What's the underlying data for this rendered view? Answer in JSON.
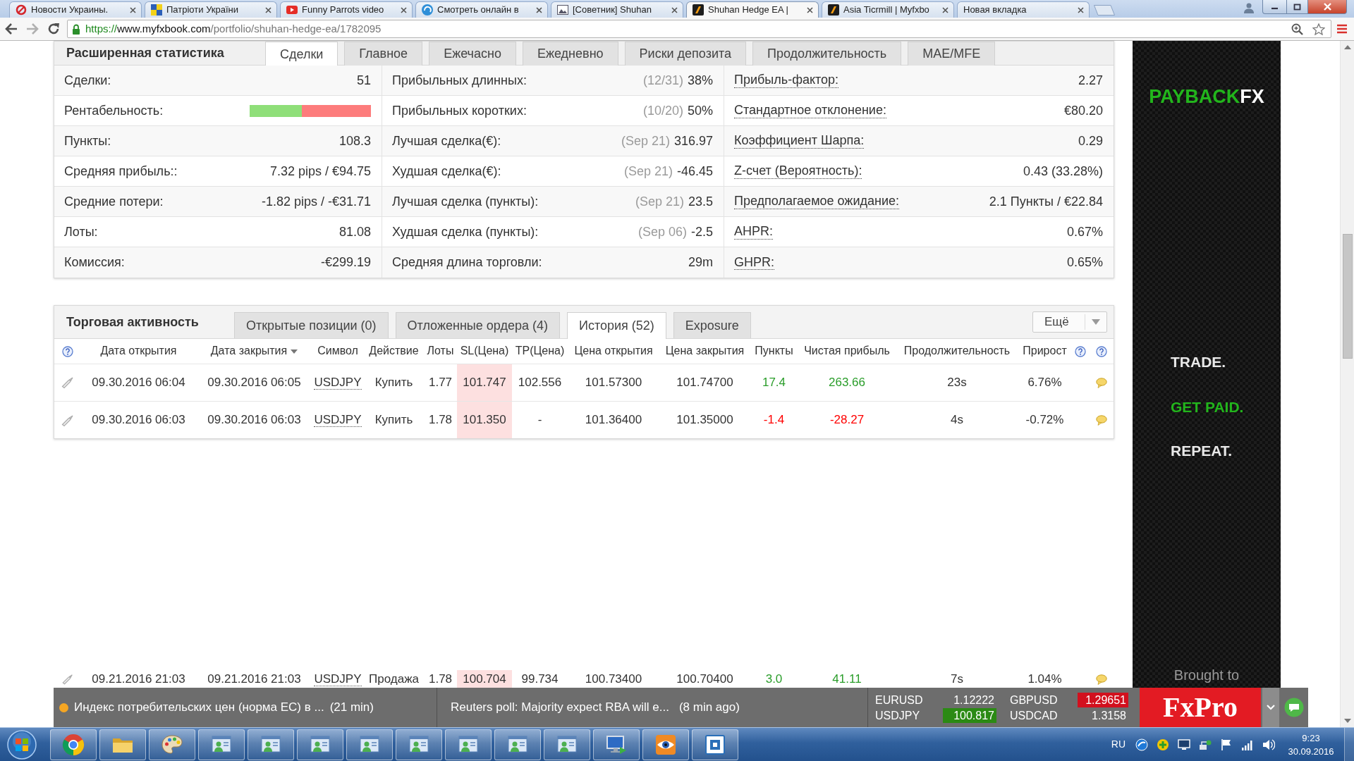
{
  "browser": {
    "tabs": [
      {
        "title": "Новости Украины.",
        "selected": false
      },
      {
        "title": "Патріоти України",
        "selected": false
      },
      {
        "title": "Funny Parrots video",
        "selected": false
      },
      {
        "title": "Смотреть онлайн в",
        "selected": false
      },
      {
        "title": "[Советник] Shuhan",
        "selected": false
      },
      {
        "title": "Shuhan Hedge EA |",
        "selected": true
      },
      {
        "title": "Asia Ticrmill | Myfxbo",
        "selected": false
      },
      {
        "title": "Новая вкладка",
        "selected": false
      }
    ],
    "address": {
      "scheme": "https://",
      "host": "www.myfxbook.com",
      "path": "/portfolio/shuhan-hedge-ea/1782095"
    }
  },
  "stats": {
    "title": "Расширенная статистика",
    "tabs": [
      {
        "label": "Сделки",
        "selected": true
      },
      {
        "label": "Главное",
        "selected": false
      },
      {
        "label": "Ежечасно",
        "selected": false
      },
      {
        "label": "Ежедневно",
        "selected": false
      },
      {
        "label": "Риски депозита",
        "selected": false
      },
      {
        "label": "Продолжительность",
        "selected": false
      },
      {
        "label": "MAE/MFE",
        "selected": false
      }
    ],
    "rows": [
      [
        {
          "kind": "text",
          "label": "Сделки:",
          "value": "51"
        },
        {
          "kind": "text",
          "label": "Прибыльных длинных:",
          "note": "(12/31)",
          "value": "38%"
        },
        {
          "kind": "text",
          "label": "Прибыль-фактор:",
          "value": "2.27"
        }
      ],
      [
        {
          "kind": "bar",
          "label": "Рентабельность:",
          "level": 0.43
        },
        {
          "kind": "text",
          "label": "Прибыльных коротких:",
          "note": "(10/20)",
          "value": "50%"
        },
        {
          "kind": "text",
          "label": "Стандартное отклонение:",
          "value": "€80.20"
        }
      ],
      [
        {
          "kind": "text",
          "label": "Пункты:",
          "value": "108.3"
        },
        {
          "kind": "text",
          "label": "Лучшая сделка(€):",
          "note": "(Sep 21)",
          "value": "316.97"
        },
        {
          "kind": "text",
          "label": "Коэффициент Шарпа:",
          "value": "0.29"
        }
      ],
      [
        {
          "kind": "text",
          "label": "Средняя прибыль::",
          "value": "7.32 pips / €94.75"
        },
        {
          "kind": "text",
          "label": "Худшая сделка(€):",
          "note": "(Sep 21)",
          "value": "-46.45"
        },
        {
          "kind": "text",
          "label": "Z-счет (Вероятность):",
          "value": "0.43 (33.28%)"
        }
      ],
      [
        {
          "kind": "text",
          "label": "Средние потери:",
          "value": "-1.82 pips / -€31.71"
        },
        {
          "kind": "text",
          "label": "Лучшая сделка (пункты):",
          "note": "(Sep 21)",
          "value": "23.5"
        },
        {
          "kind": "text",
          "label": "Предполагаемое ожидание:",
          "value": "2.1 Пункты / €22.84"
        }
      ],
      [
        {
          "kind": "text",
          "label": "Лоты:",
          "value": "81.08"
        },
        {
          "kind": "text",
          "label": "Худшая сделка (пункты):",
          "note": "(Sep 06)",
          "value": "-2.5"
        },
        {
          "kind": "text",
          "label": "AHPR:",
          "value": "0.67%"
        }
      ],
      [
        {
          "kind": "text",
          "label": "Комиссия:",
          "value": "-€299.19"
        },
        {
          "kind": "text",
          "label": "Средняя длина торговли:",
          "value": "29m"
        },
        {
          "kind": "text",
          "label": "GHPR:",
          "value": "0.65%"
        }
      ]
    ]
  },
  "trading": {
    "title": "Торговая активность",
    "tabs": [
      {
        "label": "Открытые позиции (0)",
        "selected": false
      },
      {
        "label": "Отложенные ордера (4)",
        "selected": false
      },
      {
        "label": "История (52)",
        "selected": true
      },
      {
        "label": "Exposure",
        "selected": false
      }
    ],
    "menu": "Ещё",
    "columns": [
      {
        "label": "Дата открытия",
        "sorted": false
      },
      {
        "label": "Дата закрытия",
        "sorted": true
      },
      {
        "label": "Символ",
        "sorted": false
      },
      {
        "label": "Действие",
        "sorted": false
      },
      {
        "label": "Лоты",
        "sorted": false
      },
      {
        "label": "SL(Цена)",
        "sorted": false
      },
      {
        "label": "TP(Цена)",
        "sorted": false
      },
      {
        "label": "Цена открытия",
        "sorted": false
      },
      {
        "label": "Цена закрытия",
        "sorted": false
      },
      {
        "label": "Пункты",
        "sorted": false
      },
      {
        "label": "Чистая прибыль",
        "sorted": false
      },
      {
        "label": "Продолжительность",
        "sorted": false
      },
      {
        "label": "Прирост",
        "sorted": false
      }
    ],
    "rows": [
      {
        "profit": true,
        "cells": [
          "09.30.2016 06:04",
          "09.30.2016 06:05",
          "USDJPY",
          "Купить",
          "1.77",
          "101.747",
          "102.556",
          "101.57300",
          "101.74700",
          "17.4",
          "263.66",
          "23s",
          "6.76%"
        ]
      },
      {
        "profit": false,
        "cells": [
          "09.30.2016 06:03",
          "09.30.2016 06:03",
          "USDJPY",
          "Купить",
          "1.78",
          "101.350",
          "-",
          "101.36400",
          "101.35000",
          "-1.4",
          "-28.27",
          "4s",
          "-0.72%"
        ]
      }
    ],
    "bottom_row": {
      "profit": true,
      "cells": [
        "09.21.2016 21:03",
        "09.21.2016 21:03",
        "USDJPY",
        "Продажа",
        "1.78",
        "100.704",
        "99.734",
        "100.73400",
        "100.70400",
        "3.0",
        "41.11",
        "7s",
        "1.04%"
      ]
    }
  },
  "ad": {
    "logo": {
      "word": "PAYBACK",
      "accent": "FX"
    },
    "slogans": [
      {
        "text": "TRADE.",
        "highlight": false
      },
      {
        "text": "GET PAID.",
        "highlight": true
      },
      {
        "text": "REPEAT.",
        "highlight": false
      }
    ],
    "credit": "Brought to"
  },
  "ticker": {
    "news": [
      {
        "kind": "event",
        "text": "Индекс потребительских цен (норма ЕС) в ...",
        "time": "(21 min)"
      },
      {
        "kind": "headline",
        "text": "Reuters poll: Majority expect RBA will e...",
        "time": "(8 min ago)"
      }
    ],
    "quotes": [
      {
        "symbol": "EURUSD",
        "price": "1.12222",
        "rising": false,
        "falling": false
      },
      {
        "symbol": "GBPUSD",
        "price": "1.29651",
        "rising": false,
        "falling": true
      },
      {
        "symbol": "USDJPY",
        "price": "100.817",
        "rising": true,
        "falling": false
      },
      {
        "symbol": "USDCAD",
        "price": "1.3158",
        "rising": false,
        "falling": false
      }
    ],
    "brand": "FxPro"
  },
  "taskbar": {
    "language": "RU",
    "time": "9:23",
    "date": "30.09.2016"
  }
}
